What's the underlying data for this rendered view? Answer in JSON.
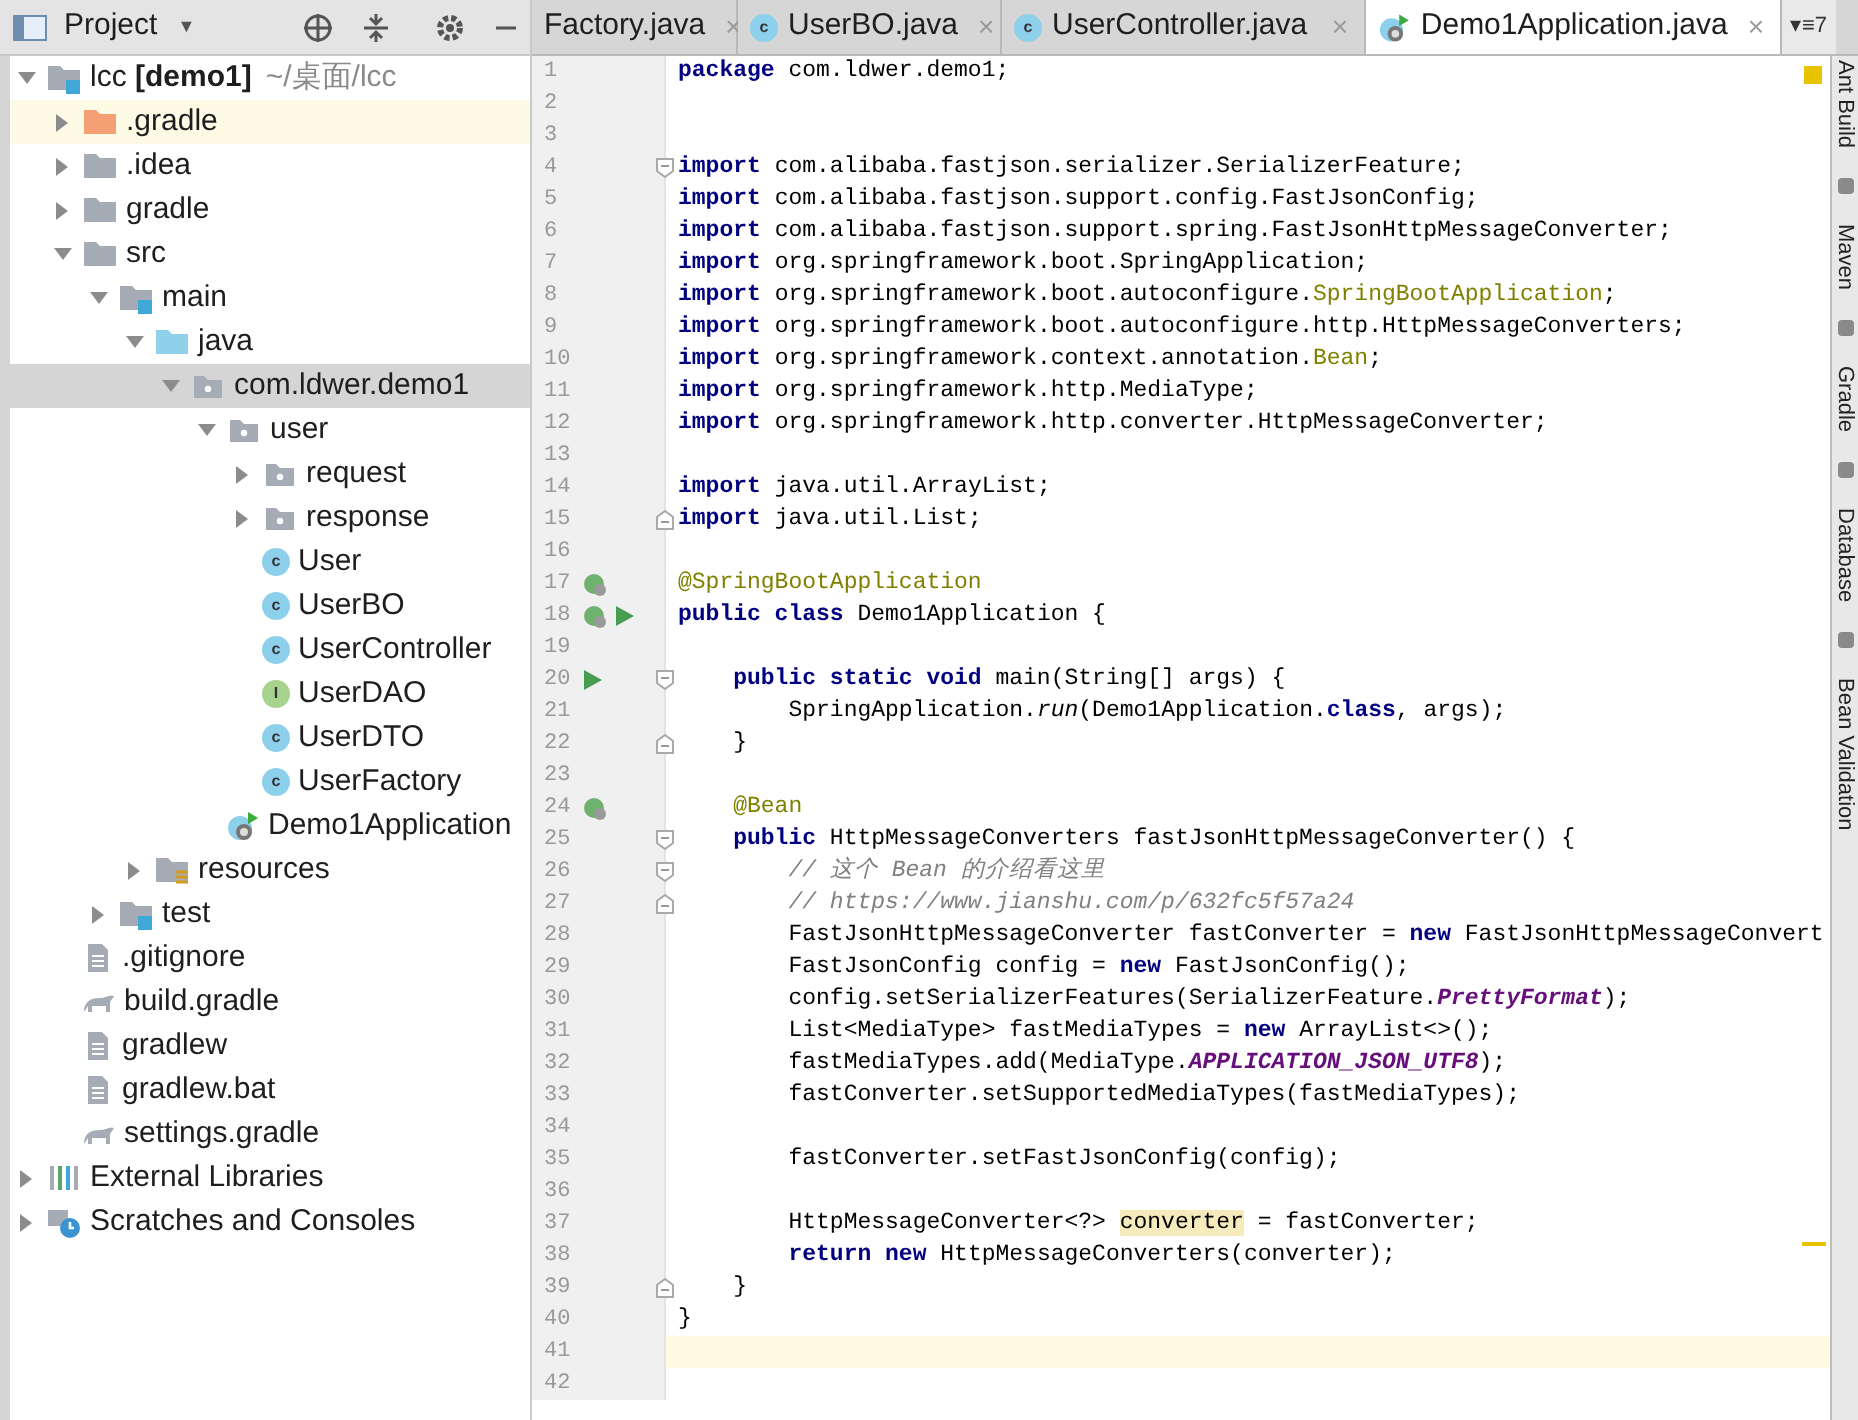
{
  "project_panel": {
    "title": "Project",
    "caret": "▼",
    "tree": [
      {
        "kind": "module",
        "label": "lcc **[demo1]**",
        "path": "~/桌面/lcc",
        "expanded": true,
        "selected": false,
        "children": [
          {
            "kind": "excluded-folder",
            "label": ".gradle",
            "expanded": false,
            "selected": false,
            "highlighted": true
          },
          {
            "kind": "folder",
            "label": ".idea",
            "expanded": false,
            "selected": false
          },
          {
            "kind": "folder",
            "label": "gradle",
            "expanded": false,
            "selected": false
          },
          {
            "kind": "folder",
            "label": "src",
            "expanded": true,
            "selected": false,
            "children": [
              {
                "kind": "module",
                "label": "main",
                "expanded": true,
                "selected": false,
                "children": [
                  {
                    "kind": "source-folder",
                    "label": "java",
                    "expanded": true,
                    "selected": false,
                    "children": [
                      {
                        "kind": "package",
                        "label": "com.ldwer.demo1",
                        "expanded": true,
                        "selected": true,
                        "children": [
                          {
                            "kind": "package",
                            "label": "user",
                            "expanded": true,
                            "selected": false,
                            "children": [
                              {
                                "kind": "package",
                                "label": "request",
                                "expanded": false,
                                "selected": false
                              },
                              {
                                "kind": "package",
                                "label": "response",
                                "expanded": false,
                                "selected": false
                              },
                              {
                                "kind": "class",
                                "badge": "c",
                                "label": "User",
                                "selected": false
                              },
                              {
                                "kind": "class",
                                "badge": "c",
                                "label": "UserBO",
                                "selected": false
                              },
                              {
                                "kind": "class",
                                "badge": "c",
                                "label": "UserController",
                                "selected": false
                              },
                              {
                                "kind": "interface",
                                "badge": "I",
                                "label": "UserDAO",
                                "selected": false
                              },
                              {
                                "kind": "class",
                                "badge": "c",
                                "label": "UserDTO",
                                "selected": false
                              },
                              {
                                "kind": "class",
                                "badge": "c",
                                "label": "UserFactory",
                                "selected": false
                              }
                            ]
                          },
                          {
                            "kind": "spring-app",
                            "label": "Demo1Application",
                            "selected": false
                          }
                        ]
                      }
                    ]
                  },
                  {
                    "kind": "resources-folder",
                    "label": "resources",
                    "expanded": false,
                    "selected": false
                  }
                ]
              },
              {
                "kind": "module",
                "label": "test",
                "expanded": false,
                "selected": false
              }
            ]
          },
          {
            "kind": "text-file",
            "label": ".gitignore",
            "selected": false
          },
          {
            "kind": "gradle-file",
            "label": "build.gradle",
            "selected": false
          },
          {
            "kind": "text-file",
            "label": "gradlew",
            "selected": false
          },
          {
            "kind": "text-file",
            "label": "gradlew.bat",
            "selected": false
          },
          {
            "kind": "gradle-file",
            "label": "settings.gradle",
            "selected": false
          }
        ]
      },
      {
        "kind": "libraries",
        "label": "External Libraries",
        "expanded": false,
        "selected": false
      },
      {
        "kind": "scratches",
        "label": "Scratches and Consoles",
        "expanded": false,
        "selected": false
      }
    ]
  },
  "tabs": [
    {
      "kind": "plain",
      "label": "Factory.java",
      "close": "×",
      "selected": false
    },
    {
      "kind": "class",
      "badge": "c",
      "label": "UserBO.java",
      "close": "×",
      "selected": false
    },
    {
      "kind": "class",
      "badge": "c",
      "label": "UserController.java",
      "close": "×",
      "selected": false
    },
    {
      "kind": "spring-app",
      "label": "Demo1Application.java",
      "close": "×",
      "selected": true
    }
  ],
  "tab_overflow": {
    "label": "▾≡7"
  },
  "editor": {
    "lines": [
      {
        "number": "1",
        "segments": [
          {
            "kind": "kw",
            "text": "package"
          },
          {
            "kind": "plain",
            "text": " com.ldwer.demo1;"
          }
        ]
      },
      {
        "number": "2"
      },
      {
        "number": "3"
      },
      {
        "number": "4",
        "fold_marker": {
          "kind": "start"
        },
        "segments": [
          {
            "kind": "kw",
            "text": "import"
          },
          {
            "kind": "plain",
            "text": " com.alibaba.fastjson.serializer.SerializerFeature;"
          }
        ]
      },
      {
        "number": "5",
        "segments": [
          {
            "kind": "kw",
            "text": "import"
          },
          {
            "kind": "plain",
            "text": " com.alibaba.fastjson.support.config.FastJsonConfig;"
          }
        ]
      },
      {
        "number": "6",
        "segments": [
          {
            "kind": "kw",
            "text": "import"
          },
          {
            "kind": "plain",
            "text": " com.alibaba.fastjson.support.spring.FastJsonHttpMessageConverter;"
          }
        ]
      },
      {
        "number": "7",
        "segments": [
          {
            "kind": "kw",
            "text": "import"
          },
          {
            "kind": "plain",
            "text": " org.springframework.boot.SpringApplication;"
          }
        ]
      },
      {
        "number": "8",
        "segments": [
          {
            "kind": "kw",
            "text": "import"
          },
          {
            "kind": "plain",
            "text": " org.springframework.boot.autoconfigure."
          },
          {
            "kind": "ann",
            "text": "SpringBootApplication"
          },
          {
            "kind": "plain",
            "text": ";"
          }
        ]
      },
      {
        "number": "9",
        "segments": [
          {
            "kind": "kw",
            "text": "import"
          },
          {
            "kind": "plain",
            "text": " org.springframework.boot.autoconfigure.http.HttpMessageConverters;"
          }
        ]
      },
      {
        "number": "10",
        "segments": [
          {
            "kind": "kw",
            "text": "import"
          },
          {
            "kind": "plain",
            "text": " org.springframework.context.annotation."
          },
          {
            "kind": "ann",
            "text": "Bean"
          },
          {
            "kind": "plain",
            "text": ";"
          }
        ]
      },
      {
        "number": "11",
        "segments": [
          {
            "kind": "kw",
            "text": "import"
          },
          {
            "kind": "plain",
            "text": " org.springframework.http.MediaType;"
          }
        ]
      },
      {
        "number": "12",
        "segments": [
          {
            "kind": "kw",
            "text": "import"
          },
          {
            "kind": "plain",
            "text": " org.springframework.http.converter.HttpMessageConverter;"
          }
        ]
      },
      {
        "number": "13"
      },
      {
        "number": "14",
        "segments": [
          {
            "kind": "kw",
            "text": "import"
          },
          {
            "kind": "plain",
            "text": " java.util.ArrayList;"
          }
        ]
      },
      {
        "number": "15",
        "fold_marker": {
          "kind": "end"
        },
        "segments": [
          {
            "kind": "kw",
            "text": "import"
          },
          {
            "kind": "plain",
            "text": " java.util.List;"
          }
        ]
      },
      {
        "number": "16"
      },
      {
        "number": "17",
        "gutter_icons": [
          {
            "kind": "bean"
          }
        ],
        "segments": [
          {
            "kind": "ann",
            "text": "@SpringBootApplication"
          }
        ]
      },
      {
        "number": "18",
        "gutter_icons": [
          {
            "kind": "bean"
          },
          {
            "kind": "run"
          }
        ],
        "segments": [
          {
            "kind": "kw",
            "text": "public class"
          },
          {
            "kind": "plain",
            "text": " Demo1Application {"
          }
        ]
      },
      {
        "number": "19"
      },
      {
        "number": "20",
        "gutter_icons": [
          {
            "kind": "run"
          }
        ],
        "fold_marker": {
          "kind": "start"
        },
        "segments": [
          {
            "kind": "kw",
            "text": "    public static void"
          },
          {
            "kind": "plain",
            "text": " main(String[] args) {"
          }
        ]
      },
      {
        "number": "21",
        "segments": [
          {
            "kind": "plain",
            "text": "        SpringApplication."
          },
          {
            "kind": "italic",
            "text": "run"
          },
          {
            "kind": "plain",
            "text": "(Demo1Application."
          },
          {
            "kind": "kw",
            "text": "class"
          },
          {
            "kind": "plain",
            "text": ", args);"
          }
        ]
      },
      {
        "number": "22",
        "fold_marker": {
          "kind": "end"
        },
        "segments": [
          {
            "kind": "plain",
            "text": "    }"
          }
        ]
      },
      {
        "number": "23"
      },
      {
        "number": "24",
        "gutter_icons": [
          {
            "kind": "bean"
          }
        ],
        "segments": [
          {
            "kind": "ann",
            "text": "    @Bean"
          }
        ]
      },
      {
        "number": "25",
        "fold_marker": {
          "kind": "start"
        },
        "segments": [
          {
            "kind": "kw",
            "text": "    public"
          },
          {
            "kind": "plain",
            "text": " HttpMessageConverters fastJsonHttpMessageConverter() {"
          }
        ]
      },
      {
        "number": "26",
        "fold_marker": {
          "kind": "start"
        },
        "segments": [
          {
            "kind": "comment",
            "text": "        // 这个 Bean 的介绍看这里"
          }
        ]
      },
      {
        "number": "27",
        "fold_marker": {
          "kind": "end"
        },
        "segments": [
          {
            "kind": "comment",
            "text": "        // https://www.jianshu.com/p/632fc5f57a24"
          }
        ]
      },
      {
        "number": "28",
        "segments": [
          {
            "kind": "plain",
            "text": "        FastJsonHttpMessageConverter fastConverter = "
          },
          {
            "kind": "kw",
            "text": "new"
          },
          {
            "kind": "plain",
            "text": " FastJsonHttpMessageConvert"
          }
        ]
      },
      {
        "number": "29",
        "segments": [
          {
            "kind": "plain",
            "text": "        FastJsonConfig config = "
          },
          {
            "kind": "kw",
            "text": "new"
          },
          {
            "kind": "plain",
            "text": " FastJsonConfig();"
          }
        ]
      },
      {
        "number": "30",
        "segments": [
          {
            "kind": "plain",
            "text": "        config.setSerializerFeatures(SerializerFeature."
          },
          {
            "kind": "const",
            "text": "PrettyFormat"
          },
          {
            "kind": "plain",
            "text": ");"
          }
        ]
      },
      {
        "number": "31",
        "segments": [
          {
            "kind": "plain",
            "text": "        List<MediaType> fastMediaTypes = "
          },
          {
            "kind": "kw",
            "text": "new"
          },
          {
            "kind": "plain",
            "text": " ArrayList<>();"
          }
        ]
      },
      {
        "number": "32",
        "segments": [
          {
            "kind": "plain",
            "text": "        fastMediaTypes.add(MediaType."
          },
          {
            "kind": "const",
            "text": "APPLICATION_JSON_UTF8"
          },
          {
            "kind": "plain",
            "text": ");"
          }
        ]
      },
      {
        "number": "33",
        "segments": [
          {
            "kind": "plain",
            "text": "        fastConverter.setSupportedMediaTypes(fastMediaTypes);"
          }
        ]
      },
      {
        "number": "34"
      },
      {
        "number": "35",
        "segments": [
          {
            "kind": "plain",
            "text": "        fastConverter.setFastJsonConfig(config);"
          }
        ]
      },
      {
        "number": "36"
      },
      {
        "number": "37",
        "segments": [
          {
            "kind": "plain",
            "text": "        HttpMessageConverter<?> "
          },
          {
            "kind": "highlight",
            "text": "converter"
          },
          {
            "kind": "plain",
            "text": " = fastConverter;"
          }
        ]
      },
      {
        "number": "38",
        "segments": [
          {
            "kind": "kw",
            "text": "        return new"
          },
          {
            "kind": "plain",
            "text": " HttpMessageConverters(converter);"
          }
        ]
      },
      {
        "number": "39",
        "fold_marker": {
          "kind": "end"
        },
        "segments": [
          {
            "kind": "plain",
            "text": "    }"
          }
        ]
      },
      {
        "number": "40",
        "segments": [
          {
            "kind": "plain",
            "text": "}"
          }
        ]
      },
      {
        "number": "41",
        "current": true
      },
      {
        "number": "42"
      }
    ]
  },
  "tool_windows": [
    "Ant Build",
    "Maven",
    "Gradle",
    "Database",
    "Bean Validation"
  ]
}
